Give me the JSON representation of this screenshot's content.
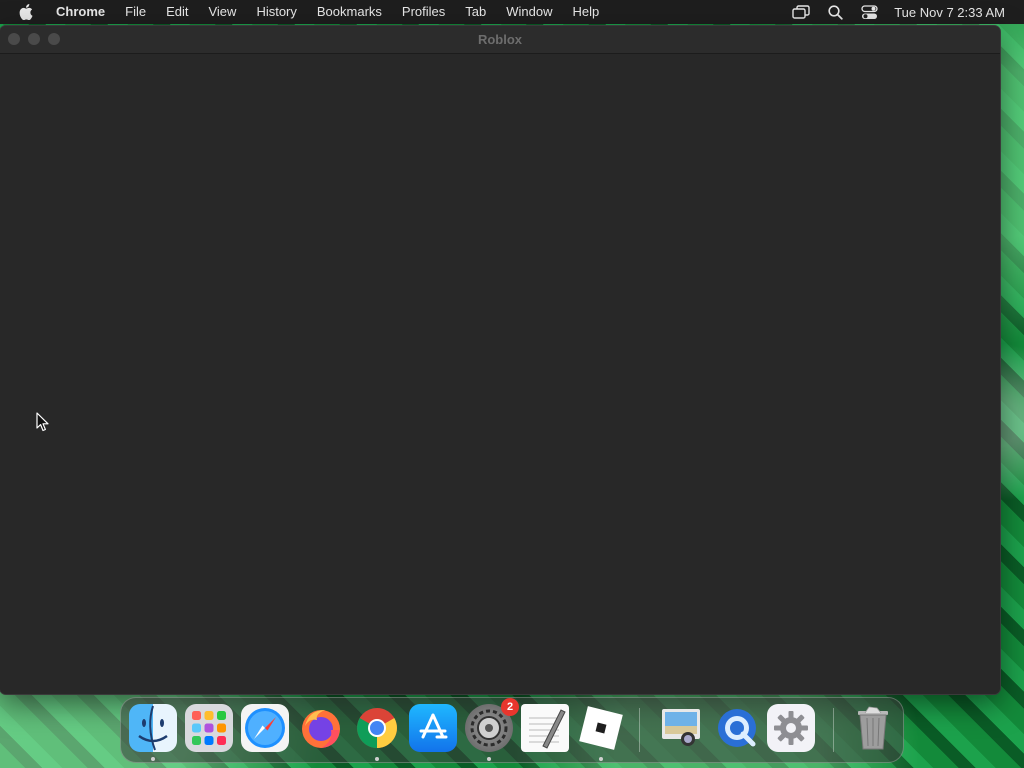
{
  "menubar": {
    "apple_icon": "apple-icon",
    "app_name": "Chrome",
    "items": [
      "File",
      "Edit",
      "View",
      "History",
      "Bookmarks",
      "Profiles",
      "Tab",
      "Window",
      "Help"
    ],
    "status_icons": [
      "screen-mirroring-icon",
      "search-icon",
      "control-center-icon"
    ],
    "clock": "Tue Nov 7  2:33 AM"
  },
  "window": {
    "title": "Roblox"
  },
  "dock": {
    "apps": [
      {
        "name": "Finder",
        "icon": "finder-icon",
        "running": true
      },
      {
        "name": "Launchpad",
        "icon": "launchpad-icon",
        "running": false
      },
      {
        "name": "Safari",
        "icon": "safari-icon",
        "running": false
      },
      {
        "name": "Firefox",
        "icon": "firefox-icon",
        "running": false
      },
      {
        "name": "Google Chrome",
        "icon": "chrome-icon",
        "running": true
      },
      {
        "name": "App Store",
        "icon": "app-store-icon",
        "running": false
      },
      {
        "name": "System Settings",
        "icon": "system-settings-icon",
        "running": true,
        "badge": "2"
      },
      {
        "name": "TextEdit",
        "icon": "textedit-icon",
        "running": false
      },
      {
        "name": "Roblox",
        "icon": "roblox-icon",
        "running": true
      },
      {
        "name": "Preview",
        "icon": "preview-icon",
        "running": false
      },
      {
        "name": "QuickTime Player",
        "icon": "quicktime-icon",
        "running": false
      },
      {
        "name": "Settings",
        "icon": "gear-icon",
        "running": false
      },
      {
        "name": "Trash",
        "icon": "trash-icon",
        "running": false
      }
    ]
  },
  "colors": {
    "menubar_bg": "#1e1e1e",
    "window_bg": "#282828",
    "badge": "#e8362d",
    "wallpaper": "#0e6b2c"
  }
}
